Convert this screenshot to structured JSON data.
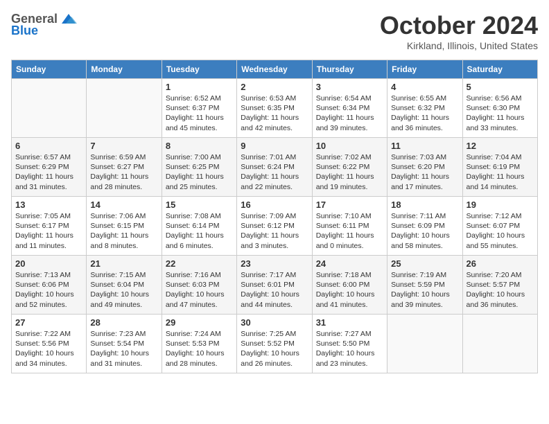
{
  "header": {
    "logo_general": "General",
    "logo_blue": "Blue",
    "month_title": "October 2024",
    "location": "Kirkland, Illinois, United States"
  },
  "days_of_week": [
    "Sunday",
    "Monday",
    "Tuesday",
    "Wednesday",
    "Thursday",
    "Friday",
    "Saturday"
  ],
  "weeks": [
    [
      {
        "day": "",
        "content": ""
      },
      {
        "day": "",
        "content": ""
      },
      {
        "day": "1",
        "content": "Sunrise: 6:52 AM\nSunset: 6:37 PM\nDaylight: 11 hours and 45 minutes."
      },
      {
        "day": "2",
        "content": "Sunrise: 6:53 AM\nSunset: 6:35 PM\nDaylight: 11 hours and 42 minutes."
      },
      {
        "day": "3",
        "content": "Sunrise: 6:54 AM\nSunset: 6:34 PM\nDaylight: 11 hours and 39 minutes."
      },
      {
        "day": "4",
        "content": "Sunrise: 6:55 AM\nSunset: 6:32 PM\nDaylight: 11 hours and 36 minutes."
      },
      {
        "day": "5",
        "content": "Sunrise: 6:56 AM\nSunset: 6:30 PM\nDaylight: 11 hours and 33 minutes."
      }
    ],
    [
      {
        "day": "6",
        "content": "Sunrise: 6:57 AM\nSunset: 6:29 PM\nDaylight: 11 hours and 31 minutes."
      },
      {
        "day": "7",
        "content": "Sunrise: 6:59 AM\nSunset: 6:27 PM\nDaylight: 11 hours and 28 minutes."
      },
      {
        "day": "8",
        "content": "Sunrise: 7:00 AM\nSunset: 6:25 PM\nDaylight: 11 hours and 25 minutes."
      },
      {
        "day": "9",
        "content": "Sunrise: 7:01 AM\nSunset: 6:24 PM\nDaylight: 11 hours and 22 minutes."
      },
      {
        "day": "10",
        "content": "Sunrise: 7:02 AM\nSunset: 6:22 PM\nDaylight: 11 hours and 19 minutes."
      },
      {
        "day": "11",
        "content": "Sunrise: 7:03 AM\nSunset: 6:20 PM\nDaylight: 11 hours and 17 minutes."
      },
      {
        "day": "12",
        "content": "Sunrise: 7:04 AM\nSunset: 6:19 PM\nDaylight: 11 hours and 14 minutes."
      }
    ],
    [
      {
        "day": "13",
        "content": "Sunrise: 7:05 AM\nSunset: 6:17 PM\nDaylight: 11 hours and 11 minutes."
      },
      {
        "day": "14",
        "content": "Sunrise: 7:06 AM\nSunset: 6:15 PM\nDaylight: 11 hours and 8 minutes."
      },
      {
        "day": "15",
        "content": "Sunrise: 7:08 AM\nSunset: 6:14 PM\nDaylight: 11 hours and 6 minutes."
      },
      {
        "day": "16",
        "content": "Sunrise: 7:09 AM\nSunset: 6:12 PM\nDaylight: 11 hours and 3 minutes."
      },
      {
        "day": "17",
        "content": "Sunrise: 7:10 AM\nSunset: 6:11 PM\nDaylight: 11 hours and 0 minutes."
      },
      {
        "day": "18",
        "content": "Sunrise: 7:11 AM\nSunset: 6:09 PM\nDaylight: 10 hours and 58 minutes."
      },
      {
        "day": "19",
        "content": "Sunrise: 7:12 AM\nSunset: 6:07 PM\nDaylight: 10 hours and 55 minutes."
      }
    ],
    [
      {
        "day": "20",
        "content": "Sunrise: 7:13 AM\nSunset: 6:06 PM\nDaylight: 10 hours and 52 minutes."
      },
      {
        "day": "21",
        "content": "Sunrise: 7:15 AM\nSunset: 6:04 PM\nDaylight: 10 hours and 49 minutes."
      },
      {
        "day": "22",
        "content": "Sunrise: 7:16 AM\nSunset: 6:03 PM\nDaylight: 10 hours and 47 minutes."
      },
      {
        "day": "23",
        "content": "Sunrise: 7:17 AM\nSunset: 6:01 PM\nDaylight: 10 hours and 44 minutes."
      },
      {
        "day": "24",
        "content": "Sunrise: 7:18 AM\nSunset: 6:00 PM\nDaylight: 10 hours and 41 minutes."
      },
      {
        "day": "25",
        "content": "Sunrise: 7:19 AM\nSunset: 5:59 PM\nDaylight: 10 hours and 39 minutes."
      },
      {
        "day": "26",
        "content": "Sunrise: 7:20 AM\nSunset: 5:57 PM\nDaylight: 10 hours and 36 minutes."
      }
    ],
    [
      {
        "day": "27",
        "content": "Sunrise: 7:22 AM\nSunset: 5:56 PM\nDaylight: 10 hours and 34 minutes."
      },
      {
        "day": "28",
        "content": "Sunrise: 7:23 AM\nSunset: 5:54 PM\nDaylight: 10 hours and 31 minutes."
      },
      {
        "day": "29",
        "content": "Sunrise: 7:24 AM\nSunset: 5:53 PM\nDaylight: 10 hours and 28 minutes."
      },
      {
        "day": "30",
        "content": "Sunrise: 7:25 AM\nSunset: 5:52 PM\nDaylight: 10 hours and 26 minutes."
      },
      {
        "day": "31",
        "content": "Sunrise: 7:27 AM\nSunset: 5:50 PM\nDaylight: 10 hours and 23 minutes."
      },
      {
        "day": "",
        "content": ""
      },
      {
        "day": "",
        "content": ""
      }
    ]
  ]
}
